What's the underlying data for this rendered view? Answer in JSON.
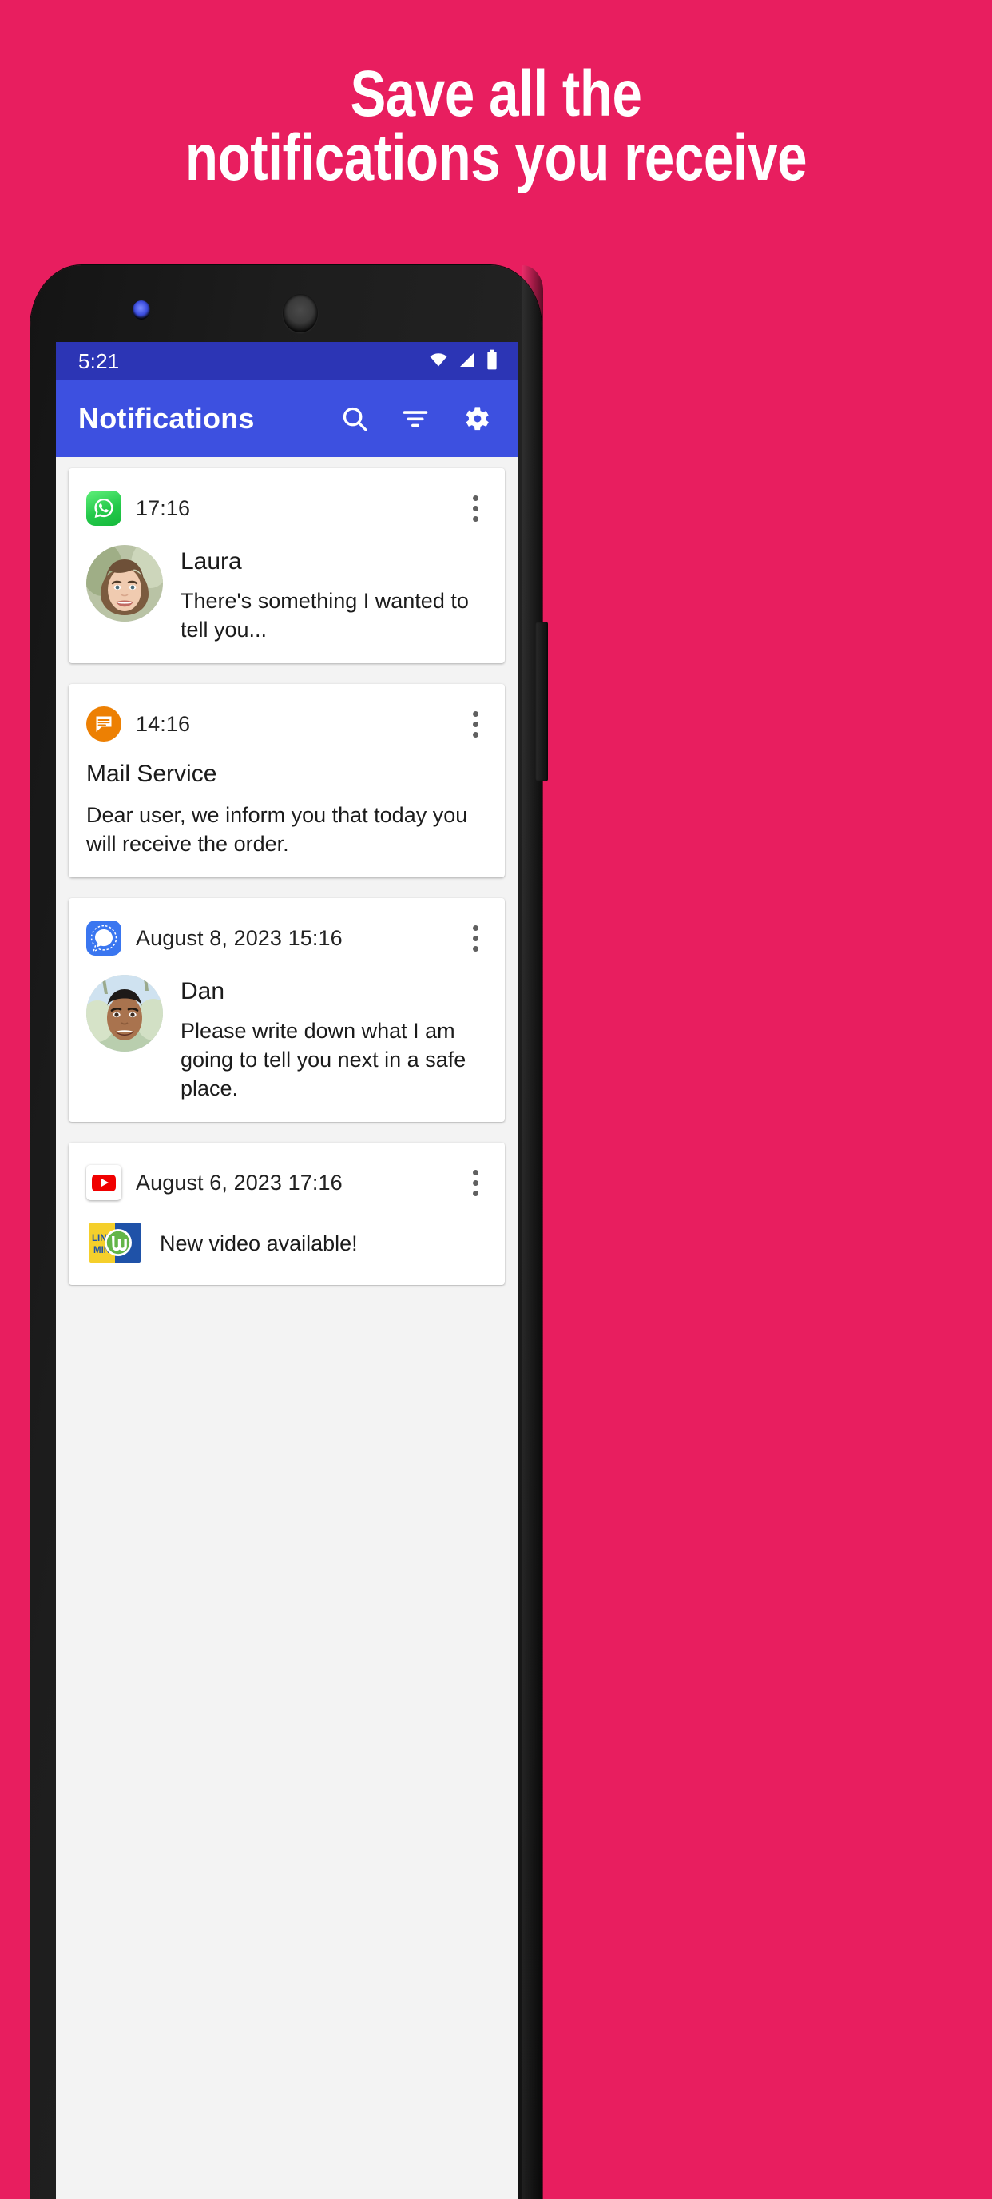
{
  "promo": {
    "background_color": "#e81e5f",
    "headline_line1": "Save all the",
    "headline_line2": "notifications you receive",
    "headline_color": "#ffffff"
  },
  "phone": {
    "frame_color": "#1a1a1a",
    "led_indicator": "notification-led",
    "camera": "front-camera",
    "power_button": "power-button"
  },
  "statusbar": {
    "background_color": "#2c35b5",
    "time": "5:21",
    "icons": [
      "wifi-icon",
      "cellular-signal-icon",
      "battery-icon"
    ]
  },
  "appbar": {
    "background_color": "#3d50e0",
    "title": "Notifications",
    "actions": [
      {
        "name": "search-icon",
        "label": "Search"
      },
      {
        "name": "filter-icon",
        "label": "Filter"
      },
      {
        "name": "settings-gear-icon",
        "label": "Settings"
      }
    ]
  },
  "notifications": [
    {
      "app": "WhatsApp",
      "app_icon": "whatsapp-icon",
      "icon_color": "#25c94b",
      "time": "17:16",
      "overflow": "more-options-icon",
      "has_avatar": true,
      "avatar": "laura-avatar",
      "sender": "Laura",
      "message": "There's something I wanted to tell you...",
      "layout": "avatar-stacked"
    },
    {
      "app": "Mail Service",
      "app_icon": "message-bubble-icon",
      "icon_color": "#ed8003",
      "time": "14:16",
      "overflow": "more-options-icon",
      "has_avatar": false,
      "title": "Mail Service",
      "message": "Dear user, we inform you that today you will receive the order.",
      "layout": "title-body"
    },
    {
      "app": "Signal",
      "app_icon": "signal-icon",
      "icon_color": "#3a76f0",
      "time": "August 8, 2023 15:16",
      "overflow": "more-options-icon",
      "has_avatar": true,
      "avatar": "dan-avatar",
      "sender": "Dan",
      "message": "Please write down what I am going to tell you next in a safe place.",
      "layout": "avatar-stacked"
    },
    {
      "app": "YouTube",
      "app_icon": "youtube-icon",
      "icon_color": "#f00000",
      "time": "August 6, 2023 17:16",
      "overflow": "more-options-icon",
      "has_avatar": true,
      "avatar": "linux-mint-logo",
      "message": "New video available!",
      "layout": "inline"
    }
  ]
}
